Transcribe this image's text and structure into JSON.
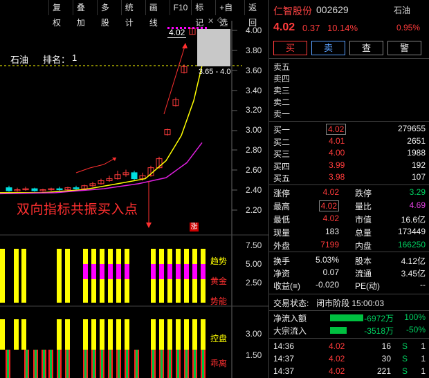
{
  "toolbar": {
    "items": [
      "复权",
      "叠加",
      "多股",
      "统计",
      "画线",
      "F10",
      "标记",
      "+自选",
      "返回"
    ]
  },
  "chart": {
    "stock_label": "石油",
    "rank_label": "排名：",
    "rank_value": "1",
    "price_badge": "4.02",
    "range_label": "3.65 - 4.0",
    "annotation": "双向指标共振买入点",
    "limit_badge": "涨",
    "price_axis": [
      "4.00",
      "3.80",
      "3.60",
      "3.40",
      "3.20",
      "3.00",
      "2.80",
      "2.60",
      "2.40",
      "2.20"
    ],
    "ind1_axis": [
      "7.50",
      "5.00",
      "2.50"
    ],
    "ind1_labels": [
      "趋势",
      "黄金",
      "势能"
    ],
    "ind2_axis": [
      "3.00",
      "1.50"
    ],
    "ind2_labels": [
      "控盘",
      "乖离"
    ],
    "colors": {
      "up": "#ff3b3b",
      "down": "#00e0e0",
      "ma_yellow": "#ffff00",
      "ma_magenta": "#e020e0",
      "bar_yellow": "#ffff00",
      "bar_magenta": "#ff00ff",
      "bar_red": "#ff2020",
      "bar_green": "#00c040"
    }
  },
  "quote": {
    "name": "仁智股份",
    "code": "002629",
    "sector": "石油",
    "price": "4.02",
    "change": "0.37",
    "change_pct": "10.14%",
    "sector_pct": "0.95%",
    "buttons": [
      "买",
      "卖",
      "查",
      "警"
    ],
    "sell_levels": [
      "卖五",
      "卖四",
      "卖三",
      "卖二",
      "卖一"
    ],
    "buy_levels": [
      {
        "label": "买一",
        "price": "4.02",
        "vol": "279655"
      },
      {
        "label": "买二",
        "price": "4.01",
        "vol": "2651"
      },
      {
        "label": "买三",
        "price": "4.00",
        "vol": "1988"
      },
      {
        "label": "买四",
        "price": "3.99",
        "vol": "192"
      },
      {
        "label": "买五",
        "price": "3.98",
        "vol": "107"
      }
    ],
    "stats": [
      {
        "l1": "涨停",
        "v1": "4.02",
        "l2": "跌停",
        "v2": "3.29"
      },
      {
        "l1": "最高",
        "v1": "4.02",
        "l2": "量比",
        "v2": "4.69"
      },
      {
        "l1": "最低",
        "v1": "4.02",
        "l2": "市值",
        "v2": "16.6亿"
      },
      {
        "l1": "现量",
        "v1": "183",
        "l2": "总量",
        "v2": "173449"
      },
      {
        "l1": "外盘",
        "v1": "7199",
        "l2": "内盘",
        "v2": "166250"
      }
    ],
    "stats2": [
      {
        "l1": "换手",
        "v1": "5.03%",
        "l2": "股本",
        "v2": "4.12亿"
      },
      {
        "l1": "净资",
        "v1": "0.07",
        "l2": "流通",
        "v2": "3.45亿"
      },
      {
        "l1": "收益(≡)",
        "v1": "-0.020",
        "l2": "PE(动)",
        "v2": "--"
      }
    ],
    "trade_status_label": "交易状态:",
    "trade_status": "闭市阶段 15:00:03",
    "flows": [
      {
        "label": "净流入额",
        "value": "-6972万",
        "pct": "100%"
      },
      {
        "label": "大宗流入",
        "value": "-3518万",
        "pct": "-50%"
      }
    ],
    "ticks": [
      {
        "time": "14:36",
        "price": "4.02",
        "vol": "16",
        "side": "S",
        "n": "1"
      },
      {
        "time": "14:37",
        "price": "4.02",
        "vol": "30",
        "side": "S",
        "n": "1"
      },
      {
        "time": "14:37",
        "price": "4.02",
        "vol": "221",
        "side": "S",
        "n": "1"
      }
    ]
  }
}
